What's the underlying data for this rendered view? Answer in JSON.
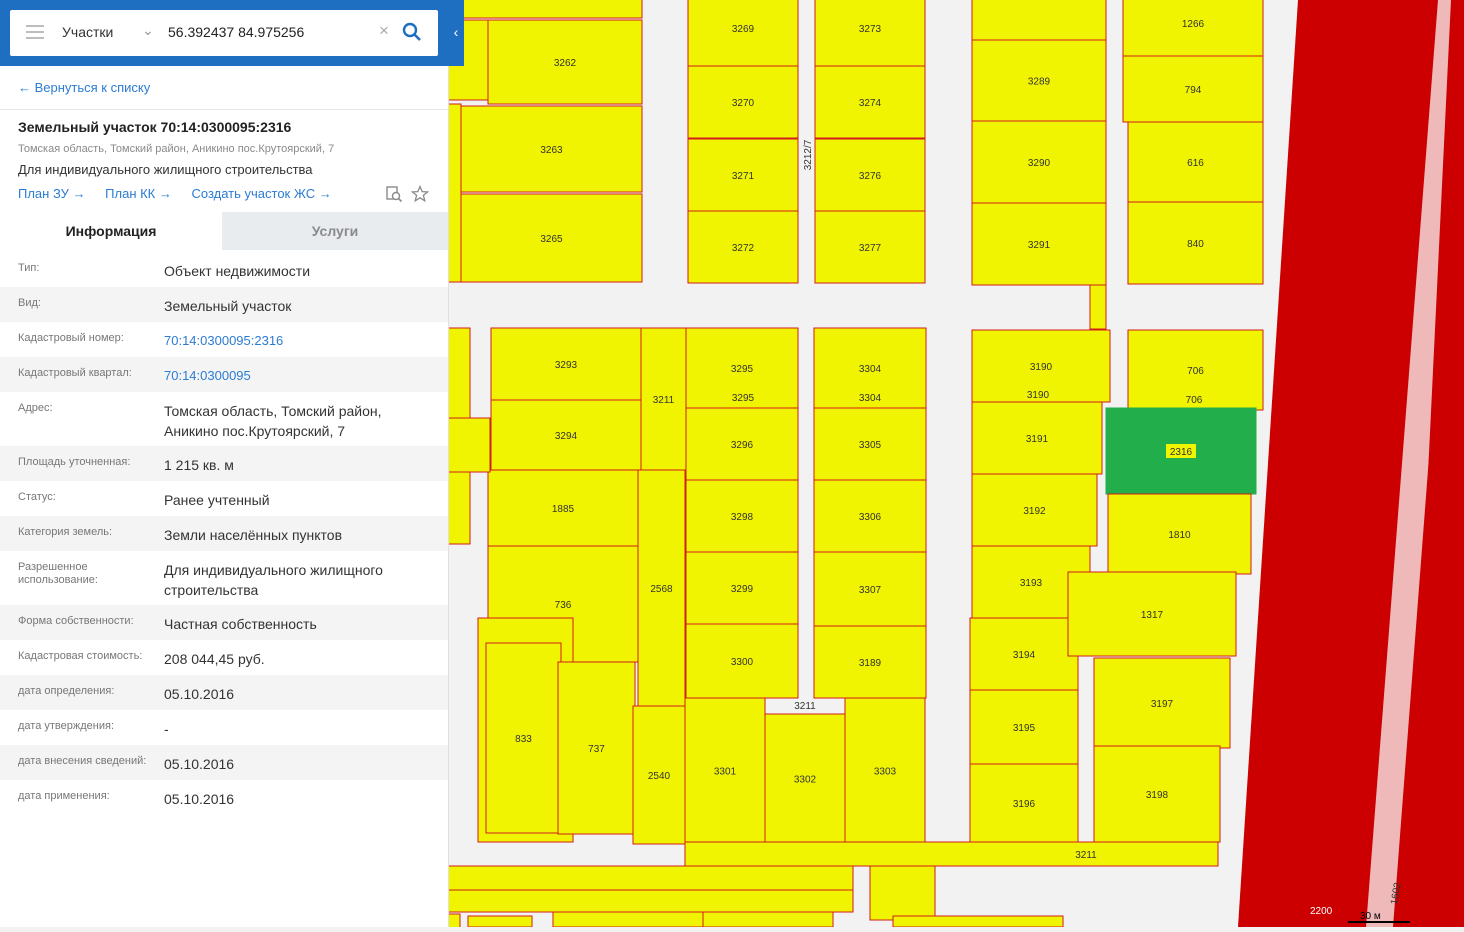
{
  "search": {
    "dropdown_label": "Участки",
    "value": "56.392437 84.975256"
  },
  "panel": {
    "back_link": "← Вернуться к списку",
    "title": "Земельный участок 70:14:0300095:2316",
    "address_small": "Томская область, Томский район, Аникино пос.Крутоярский, 7",
    "purpose": "Для индивидуального жилищного строительства",
    "links": [
      "План ЗУ →",
      "План КК →",
      "Создать участок ЖС →"
    ],
    "tabs": [
      "Информация",
      "Услуги"
    ],
    "rows": [
      {
        "k": "Тип:",
        "v": "Объект недвижимости"
      },
      {
        "k": "Вид:",
        "v": "Земельный участок"
      },
      {
        "k": "Кадастровый номер:",
        "v": "70:14:0300095:2316"
      },
      {
        "k": "Кадастровый квартал:",
        "v": "70:14:0300095"
      },
      {
        "k": "Адрес:",
        "v": "Томская область, Томский район, Аникино пос.Крутоярский, 7"
      },
      {
        "k": "Площадь уточненная:",
        "v": "1 215 кв. м"
      },
      {
        "k": "Статус:",
        "v": "Ранее учтенный"
      },
      {
        "k": "Категория земель:",
        "v": "Земли населённых пунктов"
      },
      {
        "k": "Разрешенное использование:",
        "v": "Для индивидуального жилищного строительства"
      },
      {
        "k": "Форма собственности:",
        "v": "Частная собственность"
      },
      {
        "k": "Кадастровая стоимость:",
        "v": "208 044,45 руб."
      },
      {
        "k": "дата определения:",
        "v": "05.10.2016"
      },
      {
        "k": "дата утверждения:",
        "v": "-"
      },
      {
        "k": "дата внесения сведений:",
        "v": "05.10.2016"
      },
      {
        "k": "дата применения:",
        "v": "05.10.2016"
      }
    ]
  },
  "map": {
    "parcel_labels": [
      "3262",
      "3263",
      "3265",
      "3269",
      "3270",
      "3271",
      "3272",
      "3273",
      "3274",
      "3276",
      "3277",
      "3212/7",
      "1266",
      "794",
      "616",
      "840",
      "3289",
      "3290",
      "3291",
      "3293",
      "3294",
      "1885",
      "736",
      "833",
      "737",
      "3211",
      "2568",
      "2540",
      "3295",
      "3296",
      "3298",
      "3299",
      "3300",
      "3301",
      "3302",
      "3303",
      "3304",
      "3305",
      "3306",
      "3307",
      "3189",
      "3190",
      "3191",
      "3192",
      "3193",
      "3194",
      "3195",
      "3196",
      "706",
      "2316",
      "1810",
      "1317",
      "3197",
      "3198",
      "2200",
      "1602"
    ],
    "scale_label": "30 м",
    "colors": {
      "parcel_fill": "#f0f400",
      "parcel_border": "#d21b1b",
      "selected_fill": "#22ae4a",
      "zone_red": "#cc0000",
      "zone_pink": "#efb9b9",
      "background": "#f2f2f2"
    }
  }
}
